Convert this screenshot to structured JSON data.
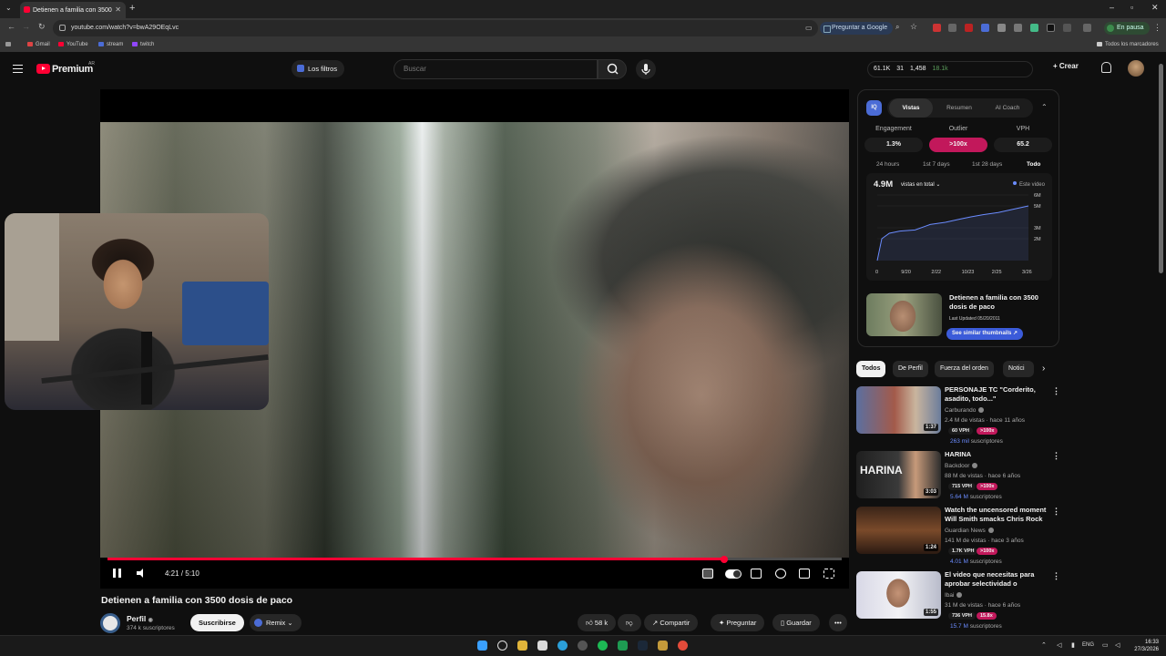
{
  "browser": {
    "tab_title": "Detienen a familia con 3500",
    "url": "youtube.com/watch?v=bwA29OEqLvc",
    "ask_google": "Preguntar a Google",
    "profile_status": "En pausa",
    "bookmarks": [
      "Gmail",
      "YouTube",
      "stream",
      "twitch"
    ],
    "all_bookmarks": "Todos los marcadores"
  },
  "youtube": {
    "brand": "Premium",
    "region": "AR",
    "filters_label": "Los filtros",
    "search_placeholder": "Buscar",
    "stats": [
      "61.1K",
      "31",
      "1,458",
      "18.1k"
    ],
    "create_label": "Crear"
  },
  "player": {
    "time": "4:21 / 5:10",
    "progress_fraction": 0.84
  },
  "video": {
    "title": "Detienen a familia con 3500 dosis de paco",
    "channel": "Perfil",
    "subscribers": "374 k suscriptores",
    "subscribe_label": "Suscribirse",
    "remix_label": "Remix",
    "likes": "58 k",
    "share_label": "Compartir",
    "ask_label": "Preguntar",
    "save_label": "Guardar"
  },
  "vidiq": {
    "logo": "IQ",
    "tabs": [
      "Vistas",
      "Resumen",
      "AI Coach"
    ],
    "metrics": [
      {
        "label": "Engagement",
        "value": "1.3%"
      },
      {
        "label": "Outlier",
        "value": ">100x"
      },
      {
        "label": "VPH",
        "value": "65.2"
      }
    ],
    "ranges": [
      "24 hours",
      "1st 7 days",
      "1st 28 days",
      "Todo"
    ],
    "total_views": "4.9M",
    "views_dropdown": "vistas en total",
    "legend": "Este video",
    "related_title": "Detienen a familia con 3500 dosis de paco",
    "related_updated": "Last Updated 05/20/2011",
    "similar_button": "See similar thumbnails"
  },
  "chart_data": {
    "type": "line",
    "x_ticks": [
      "0",
      "9/20",
      "2/22",
      "10/23",
      "2/25",
      "3/26"
    ],
    "y_ticks": [
      "6M",
      "5M",
      "3M",
      "2M",
      "0"
    ],
    "ylim": [
      0,
      6
    ],
    "series": [
      {
        "name": "Este video",
        "points": [
          [
            0,
            0
          ],
          [
            0.03,
            2.0
          ],
          [
            0.08,
            2.5
          ],
          [
            0.15,
            2.7
          ],
          [
            0.25,
            2.8
          ],
          [
            0.35,
            3.3
          ],
          [
            0.45,
            3.5
          ],
          [
            0.55,
            3.8
          ],
          [
            0.62,
            4.0
          ],
          [
            0.7,
            4.2
          ],
          [
            0.8,
            4.4
          ],
          [
            0.9,
            4.7
          ],
          [
            1.0,
            5.0
          ]
        ]
      }
    ]
  },
  "chips": [
    "Todos",
    "De Perfil",
    "Fuerza del orden",
    "Notici"
  ],
  "recommendations": [
    {
      "title": "PERSONAJE TC \"Corderito, asadito, todo...\"",
      "channel": "Carburando",
      "meta": "2.4 M de vistas · hace 11 años",
      "vph": "60 VPH",
      "outlier": ">100x",
      "subs_num": "263 mil",
      "subs_word": "suscriptores",
      "duration": "1:37"
    },
    {
      "title": "HARINA",
      "channel": "Backdoor",
      "meta": "88 M de vistas · hace 6 años",
      "vph": "715 VPH",
      "outlier": ">100x",
      "subs_num": "5.64 M",
      "subs_word": "suscriptores",
      "duration": "3:03"
    },
    {
      "title": "Watch the uncensored moment Will Smith smacks Chris Rock ...",
      "channel": "Guardian News",
      "meta": "141 M de vistas · hace 3 años",
      "vph": "1.7K VPH",
      "outlier": ">100x",
      "subs_num": "4.01 M",
      "subs_word": "suscriptores",
      "duration": "1:24"
    },
    {
      "title": "El video que necesitas para aprobar selectividad o cualqui...",
      "channel": "Ibai",
      "meta": "31 M de vistas · hace 6 años",
      "vph": "736 VPH",
      "outlier": "15.8x",
      "subs_num": "15.7 M",
      "subs_word": "suscriptores",
      "duration": "1:55"
    }
  ],
  "taskbar": {
    "lang": "ENG",
    "time": "16:33",
    "date": "27/3/2026"
  }
}
